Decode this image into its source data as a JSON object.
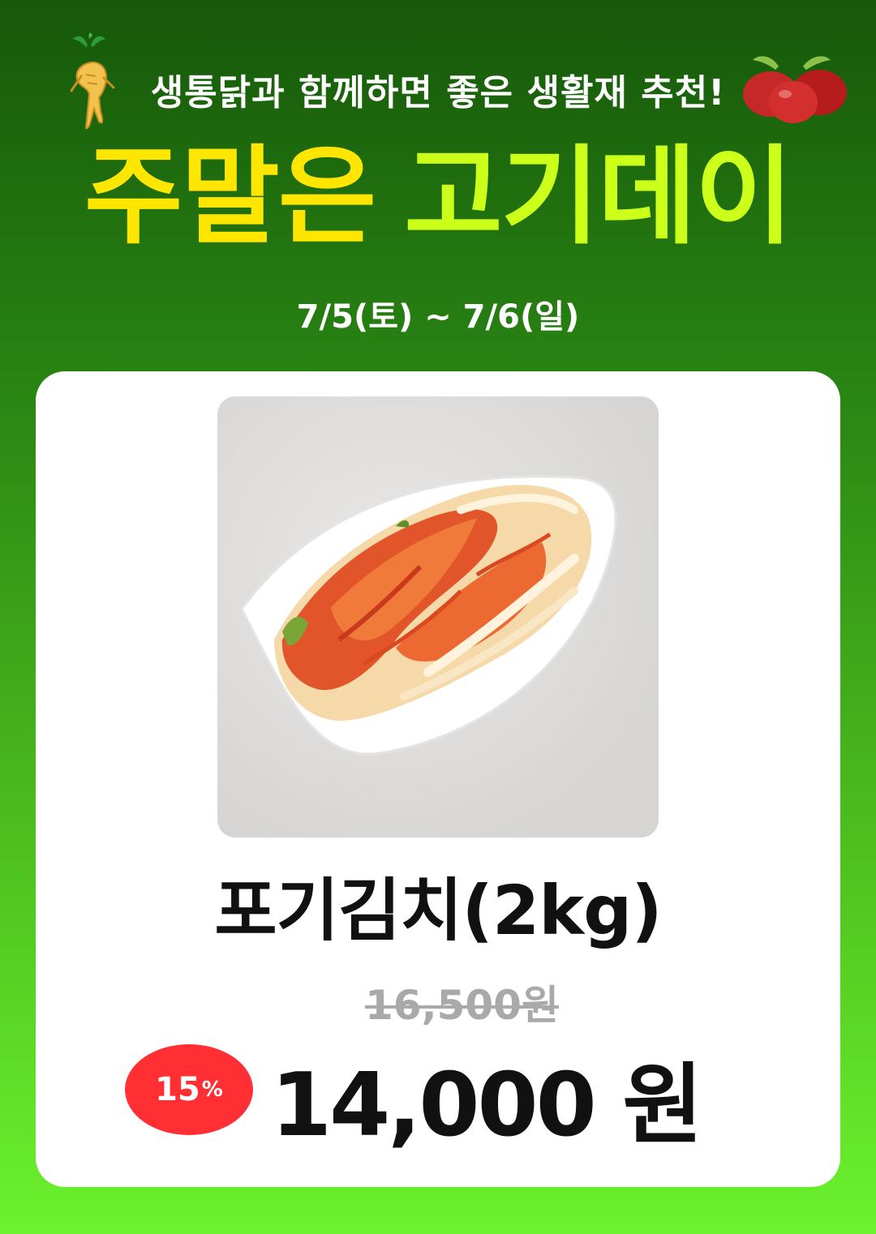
{
  "header": {
    "subtitle": "생통닭과 함께하면 좋은 생활재 추천!",
    "title_part1": "주말은",
    "title_part2": "고기데이",
    "dates": "7/5(토) ~ 7/6(일)"
  },
  "product": {
    "name": "포기김치(2kg)",
    "original_price": "16,500원",
    "discount": "15",
    "discount_unit": "%",
    "sale_price": "14,000 원"
  },
  "icons": {
    "left": "ginseng-icon",
    "right": "jujube-icon"
  },
  "colors": {
    "title_yellow": "#ffe600",
    "title_lime": "#ccff1a",
    "badge_red": "#ff2f34",
    "bg_top": "#16580a",
    "bg_bottom": "#6cf22e"
  }
}
